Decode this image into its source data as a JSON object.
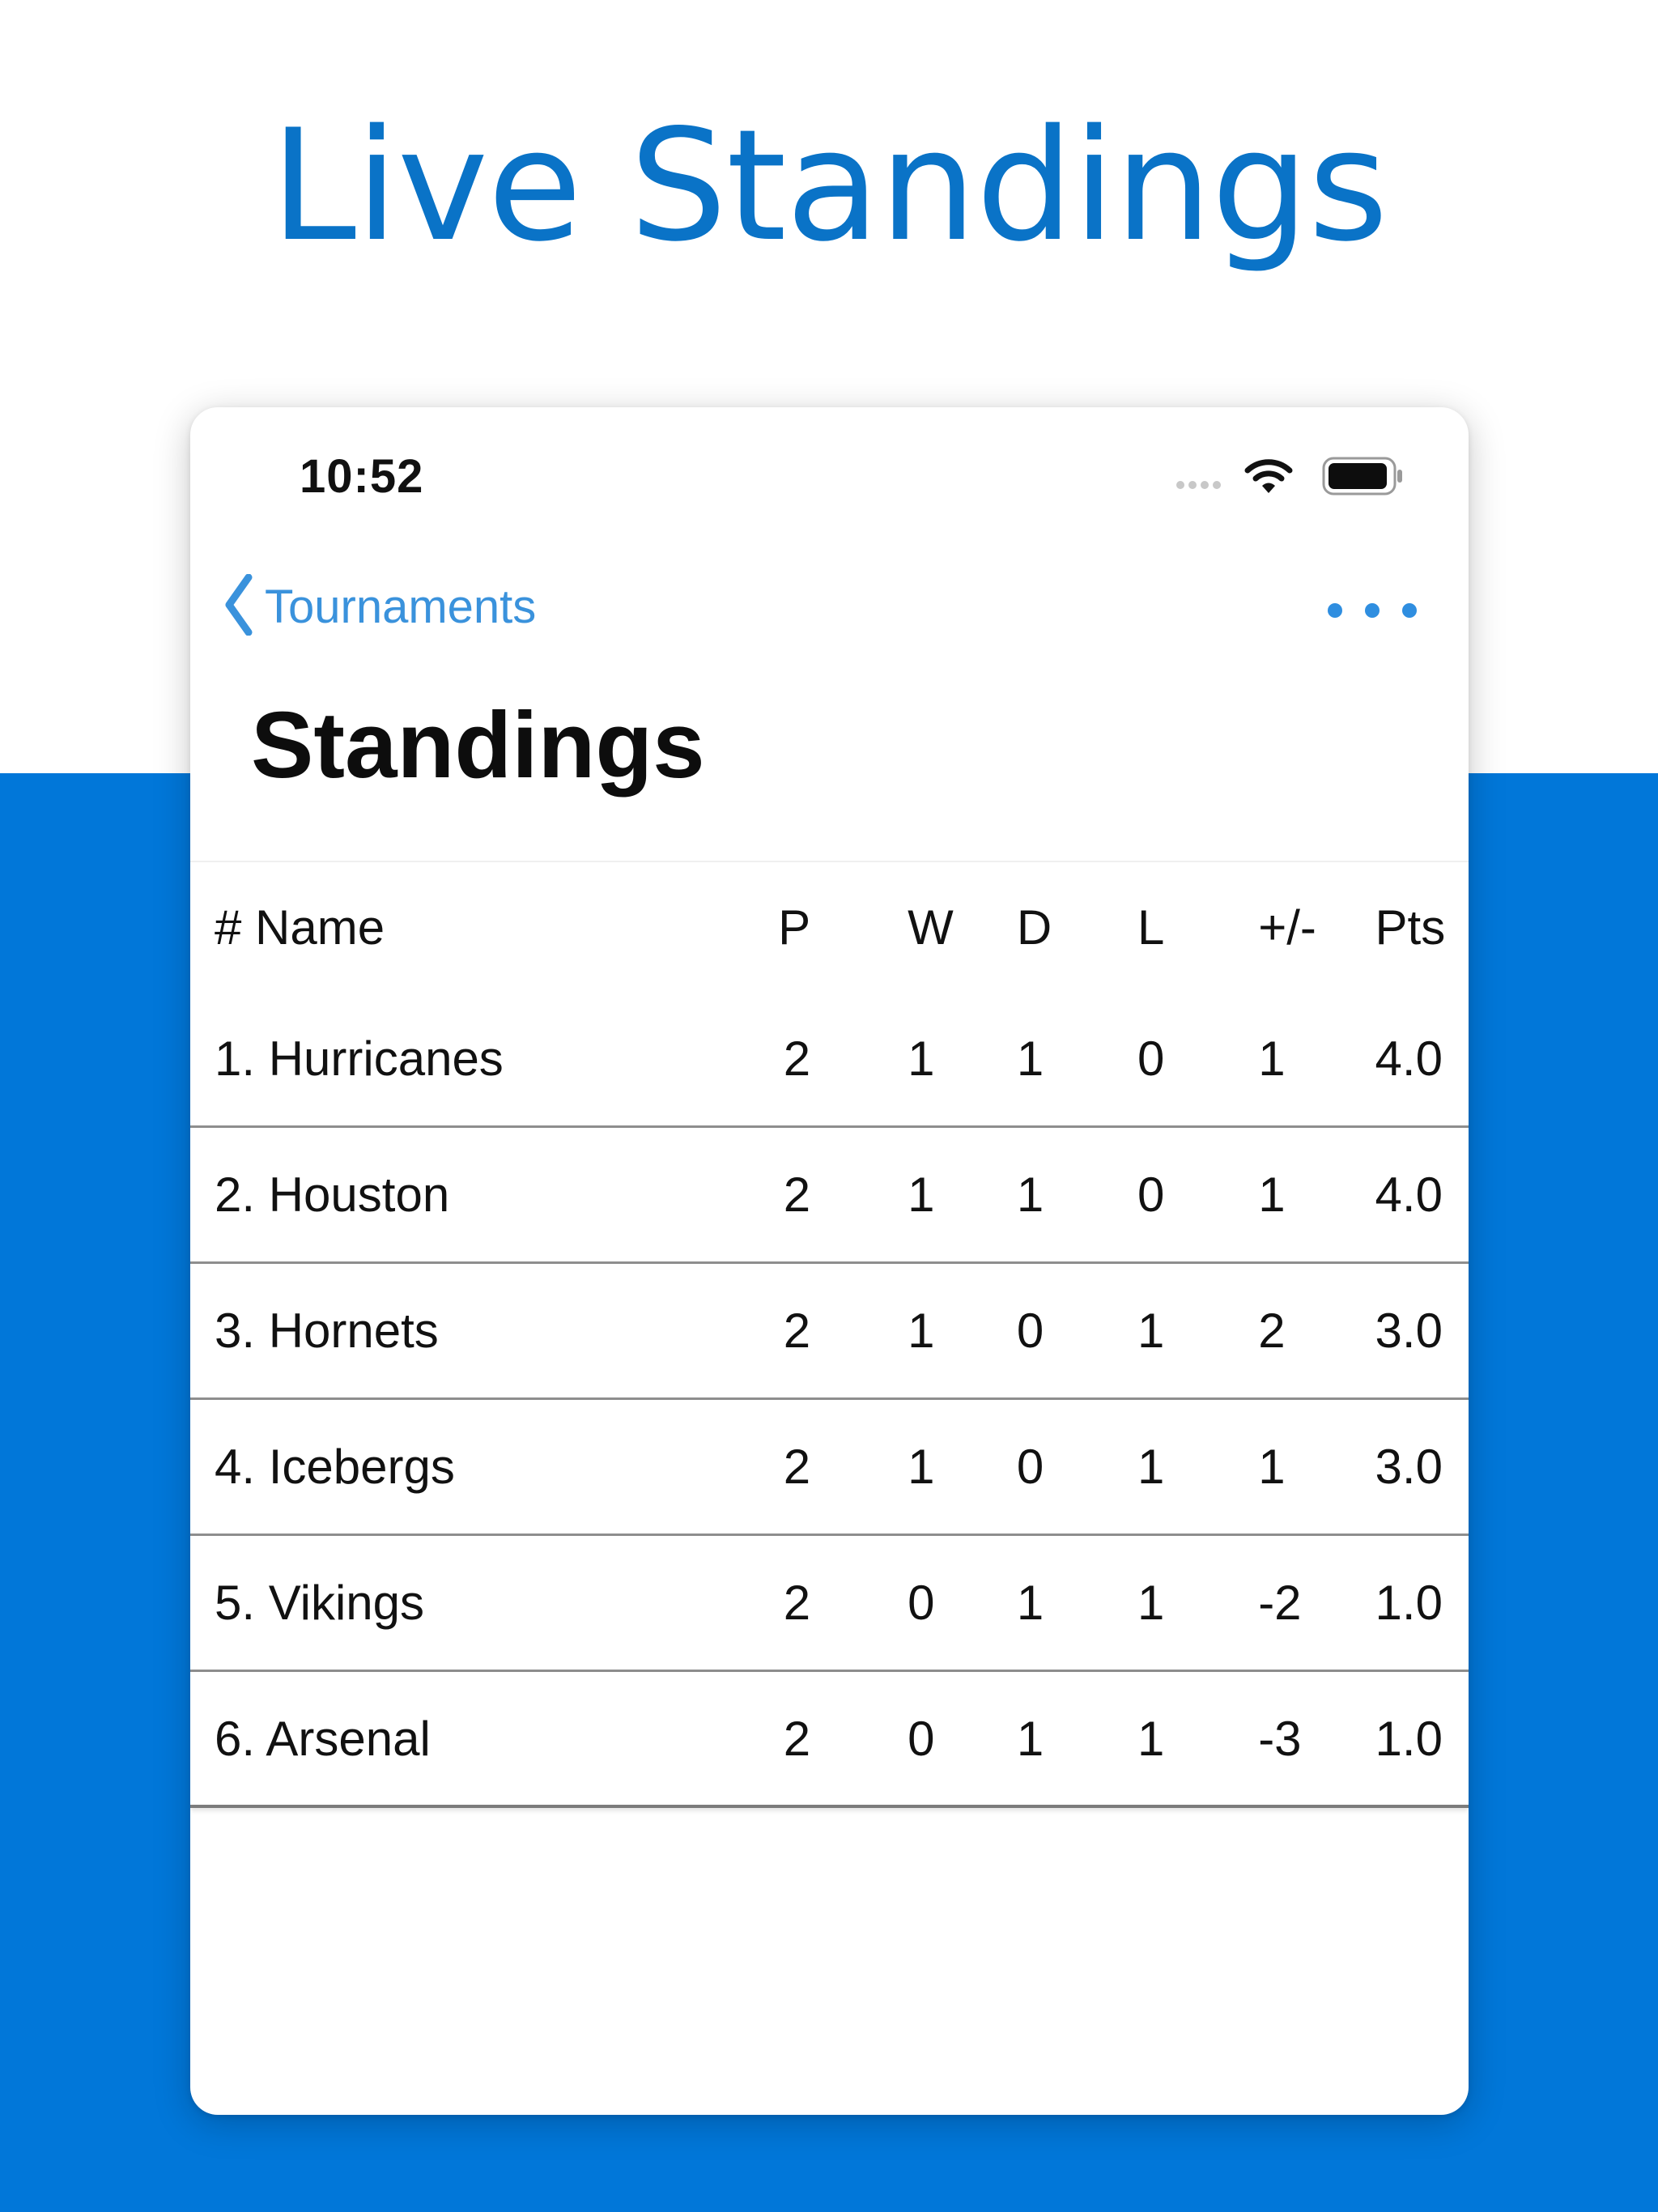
{
  "hero": {
    "title": "Live Standings"
  },
  "status_bar": {
    "time": "10:52"
  },
  "nav": {
    "back_label": "Tournaments"
  },
  "page": {
    "title": "Standings"
  },
  "table": {
    "headers": {
      "name": "# Name",
      "p": "P",
      "w": "W",
      "d": "D",
      "l": "L",
      "gd": "+/-",
      "pts": "Pts"
    },
    "rows": [
      {
        "name": "1. Hurricanes",
        "p": "2",
        "w": "1",
        "d": "1",
        "l": "0",
        "gd": "1",
        "pts": "4.0"
      },
      {
        "name": "2. Houston",
        "p": "2",
        "w": "1",
        "d": "1",
        "l": "0",
        "gd": "1",
        "pts": "4.0"
      },
      {
        "name": "3. Hornets",
        "p": "2",
        "w": "1",
        "d": "0",
        "l": "1",
        "gd": "2",
        "pts": "3.0"
      },
      {
        "name": "4. Icebergs",
        "p": "2",
        "w": "1",
        "d": "0",
        "l": "1",
        "gd": "1",
        "pts": "3.0"
      },
      {
        "name": "5. Vikings",
        "p": "2",
        "w": "0",
        "d": "1",
        "l": "1",
        "gd": "-2",
        "pts": "1.0"
      },
      {
        "name": "6. Arsenal",
        "p": "2",
        "w": "0",
        "d": "1",
        "l": "1",
        "gd": "-3",
        "pts": "1.0"
      }
    ]
  },
  "colors": {
    "accent": "#0177d9",
    "hero_text": "#0a73c7",
    "link": "#3a92dc"
  },
  "icons": {
    "back": "chevron-left-icon",
    "more": "ellipsis-icon",
    "wifi": "wifi-icon",
    "battery": "battery-icon",
    "signal": "signal-icon"
  }
}
